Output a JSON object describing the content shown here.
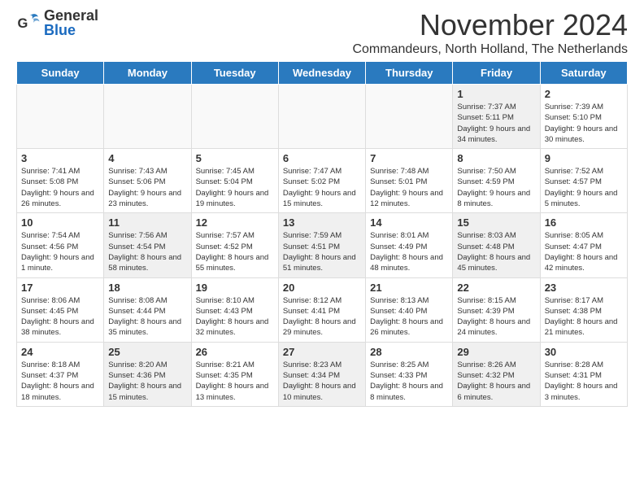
{
  "header": {
    "logo_general": "General",
    "logo_blue": "Blue",
    "month_title": "November 2024",
    "location": "Commandeurs, North Holland, The Netherlands"
  },
  "weekdays": [
    "Sunday",
    "Monday",
    "Tuesday",
    "Wednesday",
    "Thursday",
    "Friday",
    "Saturday"
  ],
  "weeks": [
    [
      {
        "day": "",
        "info": ""
      },
      {
        "day": "",
        "info": ""
      },
      {
        "day": "",
        "info": ""
      },
      {
        "day": "",
        "info": ""
      },
      {
        "day": "",
        "info": ""
      },
      {
        "day": "1",
        "info": "Sunrise: 7:37 AM\nSunset: 5:11 PM\nDaylight: 9 hours and 34 minutes."
      },
      {
        "day": "2",
        "info": "Sunrise: 7:39 AM\nSunset: 5:10 PM\nDaylight: 9 hours and 30 minutes."
      }
    ],
    [
      {
        "day": "3",
        "info": "Sunrise: 7:41 AM\nSunset: 5:08 PM\nDaylight: 9 hours and 26 minutes."
      },
      {
        "day": "4",
        "info": "Sunrise: 7:43 AM\nSunset: 5:06 PM\nDaylight: 9 hours and 23 minutes."
      },
      {
        "day": "5",
        "info": "Sunrise: 7:45 AM\nSunset: 5:04 PM\nDaylight: 9 hours and 19 minutes."
      },
      {
        "day": "6",
        "info": "Sunrise: 7:47 AM\nSunset: 5:02 PM\nDaylight: 9 hours and 15 minutes."
      },
      {
        "day": "7",
        "info": "Sunrise: 7:48 AM\nSunset: 5:01 PM\nDaylight: 9 hours and 12 minutes."
      },
      {
        "day": "8",
        "info": "Sunrise: 7:50 AM\nSunset: 4:59 PM\nDaylight: 9 hours and 8 minutes."
      },
      {
        "day": "9",
        "info": "Sunrise: 7:52 AM\nSunset: 4:57 PM\nDaylight: 9 hours and 5 minutes."
      }
    ],
    [
      {
        "day": "10",
        "info": "Sunrise: 7:54 AM\nSunset: 4:56 PM\nDaylight: 9 hours and 1 minute."
      },
      {
        "day": "11",
        "info": "Sunrise: 7:56 AM\nSunset: 4:54 PM\nDaylight: 8 hours and 58 minutes."
      },
      {
        "day": "12",
        "info": "Sunrise: 7:57 AM\nSunset: 4:52 PM\nDaylight: 8 hours and 55 minutes."
      },
      {
        "day": "13",
        "info": "Sunrise: 7:59 AM\nSunset: 4:51 PM\nDaylight: 8 hours and 51 minutes."
      },
      {
        "day": "14",
        "info": "Sunrise: 8:01 AM\nSunset: 4:49 PM\nDaylight: 8 hours and 48 minutes."
      },
      {
        "day": "15",
        "info": "Sunrise: 8:03 AM\nSunset: 4:48 PM\nDaylight: 8 hours and 45 minutes."
      },
      {
        "day": "16",
        "info": "Sunrise: 8:05 AM\nSunset: 4:47 PM\nDaylight: 8 hours and 42 minutes."
      }
    ],
    [
      {
        "day": "17",
        "info": "Sunrise: 8:06 AM\nSunset: 4:45 PM\nDaylight: 8 hours and 38 minutes."
      },
      {
        "day": "18",
        "info": "Sunrise: 8:08 AM\nSunset: 4:44 PM\nDaylight: 8 hours and 35 minutes."
      },
      {
        "day": "19",
        "info": "Sunrise: 8:10 AM\nSunset: 4:43 PM\nDaylight: 8 hours and 32 minutes."
      },
      {
        "day": "20",
        "info": "Sunrise: 8:12 AM\nSunset: 4:41 PM\nDaylight: 8 hours and 29 minutes."
      },
      {
        "day": "21",
        "info": "Sunrise: 8:13 AM\nSunset: 4:40 PM\nDaylight: 8 hours and 26 minutes."
      },
      {
        "day": "22",
        "info": "Sunrise: 8:15 AM\nSunset: 4:39 PM\nDaylight: 8 hours and 24 minutes."
      },
      {
        "day": "23",
        "info": "Sunrise: 8:17 AM\nSunset: 4:38 PM\nDaylight: 8 hours and 21 minutes."
      }
    ],
    [
      {
        "day": "24",
        "info": "Sunrise: 8:18 AM\nSunset: 4:37 PM\nDaylight: 8 hours and 18 minutes."
      },
      {
        "day": "25",
        "info": "Sunrise: 8:20 AM\nSunset: 4:36 PM\nDaylight: 8 hours and 15 minutes."
      },
      {
        "day": "26",
        "info": "Sunrise: 8:21 AM\nSunset: 4:35 PM\nDaylight: 8 hours and 13 minutes."
      },
      {
        "day": "27",
        "info": "Sunrise: 8:23 AM\nSunset: 4:34 PM\nDaylight: 8 hours and 10 minutes."
      },
      {
        "day": "28",
        "info": "Sunrise: 8:25 AM\nSunset: 4:33 PM\nDaylight: 8 hours and 8 minutes."
      },
      {
        "day": "29",
        "info": "Sunrise: 8:26 AM\nSunset: 4:32 PM\nDaylight: 8 hours and 6 minutes."
      },
      {
        "day": "30",
        "info": "Sunrise: 8:28 AM\nSunset: 4:31 PM\nDaylight: 8 hours and 3 minutes."
      }
    ]
  ]
}
